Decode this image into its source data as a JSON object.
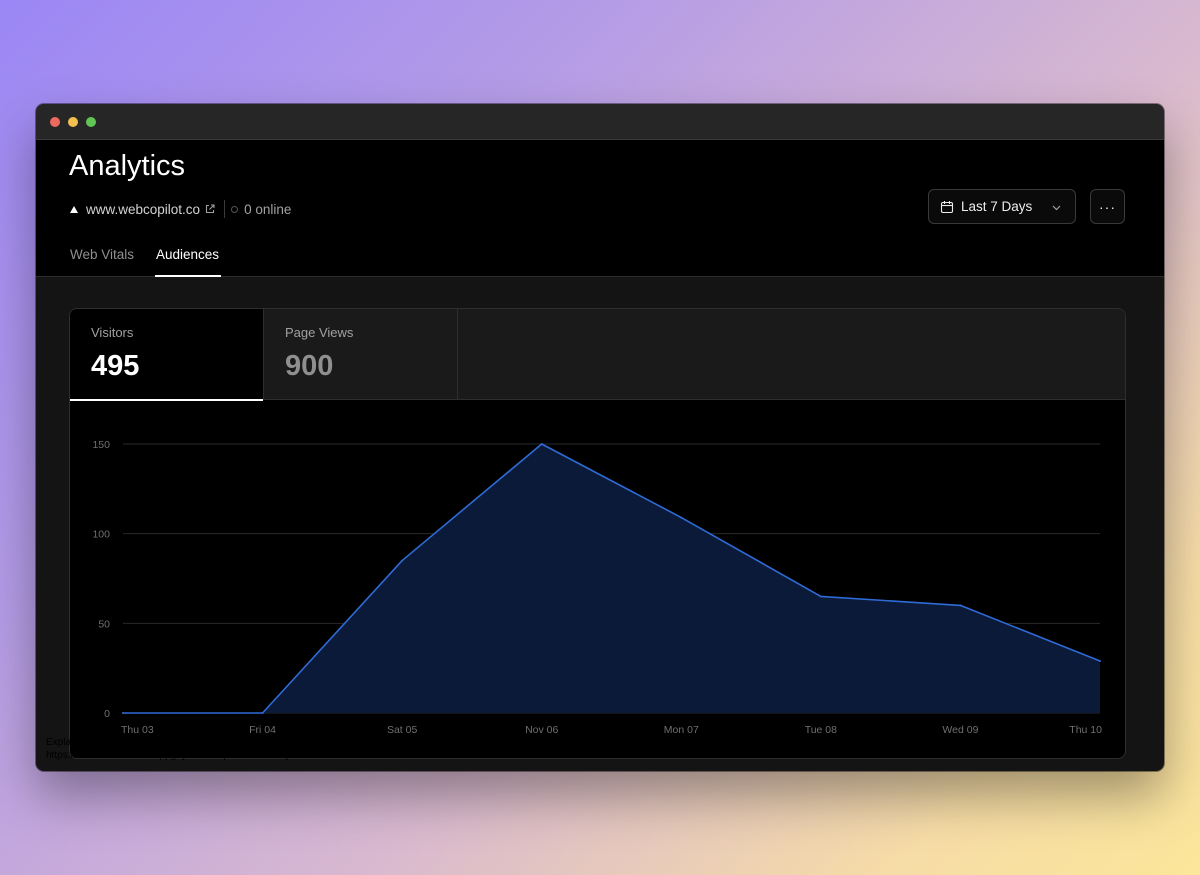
{
  "window": {
    "controls": [
      "close",
      "minimize",
      "maximize"
    ]
  },
  "header": {
    "title": "Analytics",
    "site_url": "www.webcopilot.co",
    "online_status": "0 online",
    "date_range": "Last 7 Days",
    "more_label": "···",
    "icons": {
      "site": "triangle-logo-icon",
      "external": "external-link-icon",
      "calendar": "calendar-icon",
      "chevron": "chevron-down-icon"
    }
  },
  "tabs": [
    {
      "label": "Web Vitals",
      "active": false
    },
    {
      "label": "Audiences",
      "active": true
    }
  ],
  "metrics": [
    {
      "label": "Visitors",
      "value": "495",
      "active": true
    },
    {
      "label": "Page Views",
      "value": "900",
      "active": false
    }
  ],
  "chart_data": {
    "type": "area",
    "x": [
      "Thu 03",
      "Fri 04",
      "Sat 05",
      "Nov 06",
      "Mon 07",
      "Tue 08",
      "Wed 09",
      "Thu 10"
    ],
    "series": [
      {
        "values": [
          0,
          0,
          85,
          150,
          109,
          65,
          60,
          29
        ]
      }
    ],
    "ylim": [
      0,
      150
    ],
    "yticks": [
      0,
      50,
      100,
      150
    ],
    "grid": true,
    "line_color": "#2f6bd6",
    "fill_color": "#0b1a38"
  },
  "overlay": {
    "line1": "Explain and Send Screenshots",
    "line2": "https://vercel.com/indianappguys/webcopilot-web/analytics/audience"
  }
}
